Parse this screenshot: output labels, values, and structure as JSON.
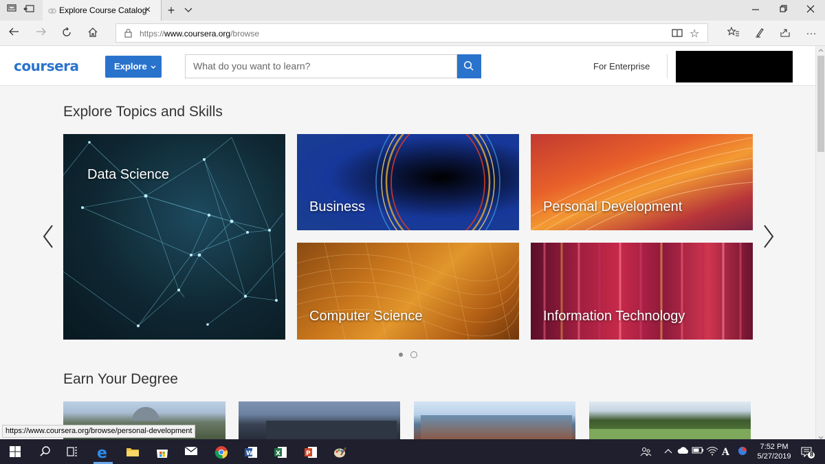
{
  "browser": {
    "tab_title": "Explore Course Catalog",
    "url_prefix": "https://",
    "url_host": "www.coursera.org",
    "url_path": "/browse"
  },
  "header": {
    "logo": "coursera",
    "explore_label": "Explore",
    "search_placeholder": "What do you want to learn?",
    "enterprise_label": "For Enterprise"
  },
  "topics": {
    "title": "Explore Topics and Skills",
    "cards": [
      {
        "label": "Data Science"
      },
      {
        "label": "Business"
      },
      {
        "label": "Personal Development"
      },
      {
        "label": "Computer Science"
      },
      {
        "label": "Information Technology"
      }
    ]
  },
  "degree": {
    "title": "Earn Your Degree"
  },
  "status_url": "https://www.coursera.org/browse/personal-development",
  "taskbar": {
    "time": "7:52 PM",
    "date": "5/27/2019",
    "notifications": "8"
  },
  "colors": {
    "accent": "#2a73cc"
  }
}
